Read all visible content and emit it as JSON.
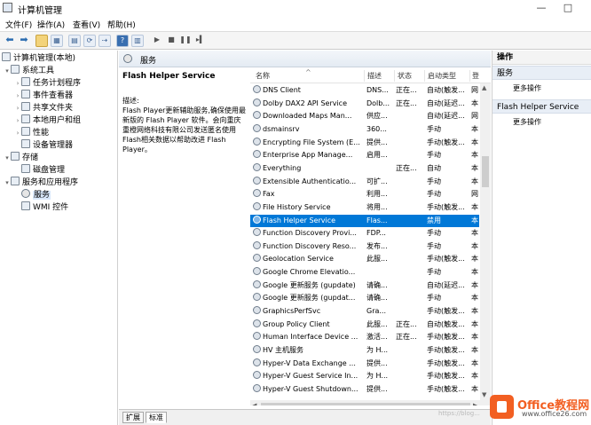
{
  "window": {
    "title": "计算机管理",
    "minimize": "—",
    "maximize": "□"
  },
  "menu": {
    "file": "文件(F)",
    "action": "操作(A)",
    "view": "查看(V)",
    "help": "帮助(H)"
  },
  "toolbar": {
    "icons": [
      "back-icon",
      "forward-icon",
      "folder-icon",
      "console-tree-icon",
      "refresh-icon",
      "export-icon",
      "properties-icon",
      "help-icon",
      "show-hide-icon",
      "play-icon",
      "stop-icon",
      "pause-icon",
      "restart-icon"
    ]
  },
  "tree": {
    "items": [
      {
        "label": "计算机管理(本地)",
        "level": 0,
        "expander": "",
        "icon": "computer-icon"
      },
      {
        "label": "系统工具",
        "level": 1,
        "expander": "▾",
        "icon": "tools-icon"
      },
      {
        "label": "任务计划程序",
        "level": 2,
        "expander": "›",
        "icon": "clock-icon"
      },
      {
        "label": "事件查看器",
        "level": 2,
        "expander": "›",
        "icon": "event-icon"
      },
      {
        "label": "共享文件夹",
        "level": 2,
        "expander": "›",
        "icon": "share-folder-icon"
      },
      {
        "label": "本地用户和组",
        "level": 2,
        "expander": "›",
        "icon": "users-icon"
      },
      {
        "label": "性能",
        "level": 2,
        "expander": "›",
        "icon": "performance-icon"
      },
      {
        "label": "设备管理器",
        "level": 2,
        "expander": "",
        "icon": "device-icon"
      },
      {
        "label": "存储",
        "level": 1,
        "expander": "▾",
        "icon": "storage-icon"
      },
      {
        "label": "磁盘管理",
        "level": 2,
        "expander": "",
        "icon": "disk-icon"
      },
      {
        "label": "服务和应用程序",
        "level": 1,
        "expander": "▾",
        "icon": "services-app-icon"
      },
      {
        "label": "服务",
        "level": 2,
        "expander": "",
        "icon": "gear-icon",
        "selected": true
      },
      {
        "label": "WMI 控件",
        "level": 2,
        "expander": "",
        "icon": "wmi-icon"
      }
    ]
  },
  "panel": {
    "header": "服务",
    "description": {
      "service_name": "Flash Helper Service",
      "label": "描述:",
      "text": "Flash Player更新辅助服务,确保使用最新版的 Flash Player 软件。会向重庆重橙网络科技有限公司发送匿名使用Flash相关数据以帮助改进 Flash Player。"
    },
    "columns": {
      "name": "名称",
      "description": "描述",
      "status": "状态",
      "startup": "启动类型",
      "logon": "登"
    },
    "rows": [
      {
        "name": "DNS Client",
        "desc": "DNS...",
        "status": "正在...",
        "startup": "自动(触发...",
        "logon": "网"
      },
      {
        "name": "Dolby DAX2 API Service",
        "desc": "Dolb...",
        "status": "正在...",
        "startup": "自动(延迟...",
        "logon": "本"
      },
      {
        "name": "Downloaded Maps Man...",
        "desc": "供应...",
        "status": "",
        "startup": "自动(延迟...",
        "logon": "网"
      },
      {
        "name": "dsmainsrv",
        "desc": "360...",
        "status": "",
        "startup": "手动",
        "logon": "本"
      },
      {
        "name": "Encrypting File System (E...",
        "desc": "提供...",
        "status": "",
        "startup": "手动(触发...",
        "logon": "本"
      },
      {
        "name": "Enterprise App Manage...",
        "desc": "启用...",
        "status": "",
        "startup": "手动",
        "logon": "本"
      },
      {
        "name": "Everything",
        "desc": "",
        "status": "正在...",
        "startup": "自动",
        "logon": "本"
      },
      {
        "name": "Extensible Authenticatio...",
        "desc": "可扩...",
        "status": "",
        "startup": "手动",
        "logon": "本"
      },
      {
        "name": "Fax",
        "desc": "利用...",
        "status": "",
        "startup": "手动",
        "logon": "网"
      },
      {
        "name": "File History Service",
        "desc": "将用...",
        "status": "",
        "startup": "手动(触发...",
        "logon": "本"
      },
      {
        "name": "Flash Helper Service",
        "desc": "Flas...",
        "status": "",
        "startup": "禁用",
        "logon": "本",
        "selected": true
      },
      {
        "name": "Function Discovery Provi...",
        "desc": "FDP...",
        "status": "",
        "startup": "手动",
        "logon": "本"
      },
      {
        "name": "Function Discovery Reso...",
        "desc": "发布...",
        "status": "",
        "startup": "手动",
        "logon": "本"
      },
      {
        "name": "Geolocation Service",
        "desc": "此服...",
        "status": "",
        "startup": "手动(触发...",
        "logon": "本"
      },
      {
        "name": "Google Chrome Elevatio...",
        "desc": "",
        "status": "",
        "startup": "手动",
        "logon": "本"
      },
      {
        "name": "Google 更新服务 (gupdate)",
        "desc": "请确...",
        "status": "",
        "startup": "自动(延迟...",
        "logon": "本"
      },
      {
        "name": "Google 更新服务 (gupdat...",
        "desc": "请确...",
        "status": "",
        "startup": "手动",
        "logon": "本"
      },
      {
        "name": "GraphicsPerfSvc",
        "desc": "Gra...",
        "status": "",
        "startup": "手动(触发...",
        "logon": "本"
      },
      {
        "name": "Group Policy Client",
        "desc": "此服...",
        "status": "正在...",
        "startup": "自动(触发...",
        "logon": "本"
      },
      {
        "name": "Human Interface Device ...",
        "desc": "激活...",
        "status": "正在...",
        "startup": "手动(触发...",
        "logon": "本"
      },
      {
        "name": "HV 主机服务",
        "desc": "为 H...",
        "status": "",
        "startup": "手动(触发...",
        "logon": "本"
      },
      {
        "name": "Hyper-V Data Exchange ...",
        "desc": "提供...",
        "status": "",
        "startup": "手动(触发...",
        "logon": "本"
      },
      {
        "name": "Hyper-V Guest Service In...",
        "desc": "为 H...",
        "status": "",
        "startup": "手动(触发...",
        "logon": "本"
      },
      {
        "name": "Hyper-V Guest Shutdown...",
        "desc": "提供...",
        "status": "",
        "startup": "手动(触发...",
        "logon": "本"
      }
    ]
  },
  "tabs": {
    "extended": "扩展",
    "standard": "标准"
  },
  "actions": {
    "title": "操作",
    "section1": "服务",
    "more1": "更多操作",
    "section2": "Flash Helper Service",
    "more2": "更多操作"
  },
  "watermark": {
    "brand": "Office教程网",
    "url": "www.office26.com",
    "sub": "https://blog..."
  }
}
